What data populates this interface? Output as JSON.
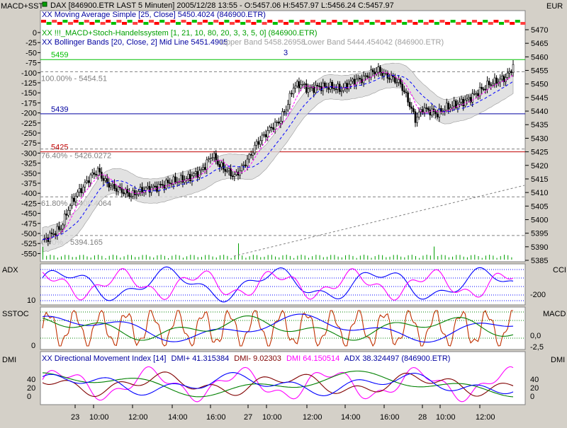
{
  "corner": {
    "left_title": "MACD+SST",
    "right_currency": "EUR"
  },
  "header": {
    "main": "DAX [846900.ETR LAST 5 Minuten] 2005/12/28 13:55 - O:5457.06 H:5457.97 L:5456.24 C:5457.97",
    "sma": "XX Moving Average Simple [25, Close] 5450.4024 (846900.ETR)",
    "system1": "XX !!!_MACD+Stoch-Handelssystem [1, 21, 10, 80, 20, 3, 3, 5, 0] (846900.ETR)",
    "bollinger": "XX Bollinger Bands [20, Close, 2] Mid Line 5451.4905",
    "bollinger_upper": "Upper Band 5458.26958",
    "bollinger_lower": "Lower Band 5444.454042 (846900.ETR)",
    "marker": "3"
  },
  "levels": {
    "line_5459": "5459",
    "line_5439": "5439",
    "line_5425": "5425",
    "fib_100": "100.00% - 5454.51",
    "fib_76": "76.40% - 5426.0272",
    "fib_61": "61.80% - 5408.4064",
    "fib_0": "0.00% - 5394.165"
  },
  "panels": {
    "adx_label": "ADX",
    "cci_label": "CCI",
    "sstoc_label": "SSTOC",
    "macd_label": "MACD",
    "dmi_label": "DMI",
    "dmi_right_label": "DMI",
    "dmi_header": "XX Directional Movement Index [14]",
    "dmi_plus": "DMI+ 41.315384",
    "dmi_minus": "DMI- 9.02303",
    "dmi_other": "DMI 64.150514",
    "dmi_adx": "ADX 38.324497 (846900.ETR)"
  },
  "colors": {
    "background": "#ffffff",
    "frame": "#d4d0c8",
    "candles": "#000000",
    "sma": "#0000ff",
    "price_line": "#ff00ff",
    "bollinger": "#808080",
    "level_green": "#00c000",
    "level_blue": "#0000a0",
    "level_red": "#c00000",
    "volume": "#00a000",
    "adx": "#0000ff",
    "cci": "#ff00ff",
    "stoch_k": "#c03000",
    "stoch_d": "#008000",
    "macd": "#0000ff",
    "dmi_plus": "#ff00ff",
    "dmi_minus": "#800000",
    "dmi_adx": "#008000"
  },
  "chart_data": {
    "type": "candlestick",
    "left_axis_ticks": [
      "0",
      "-25",
      "-50",
      "-75",
      "-100",
      "-125",
      "-150",
      "-175",
      "-200",
      "-225",
      "-250",
      "-275",
      "-300",
      "-325",
      "-350",
      "-375",
      "-400",
      "-425",
      "-450",
      "-475",
      "-500",
      "-525",
      "-550"
    ],
    "right_axis_ticks": [
      "5470",
      "5465",
      "5460",
      "5455",
      "5450",
      "5445",
      "5440",
      "5435",
      "5430",
      "5425",
      "5420",
      "5415",
      "5410",
      "5405",
      "5400",
      "5395",
      "5390",
      "5385"
    ],
    "ylim": [
      5383,
      5473
    ],
    "x_ticks": [
      "23",
      "10:00",
      "12:00",
      "14:00",
      "16:00",
      "27",
      "10:00",
      "12:00",
      "14:00",
      "16:00",
      "28",
      "10:00",
      "12:00"
    ],
    "close_anchors": [
      [
        0,
        5392
      ],
      [
        6,
        5395
      ],
      [
        10,
        5397
      ],
      [
        14,
        5404
      ],
      [
        18,
        5409
      ],
      [
        22,
        5412
      ],
      [
        26,
        5416
      ],
      [
        30,
        5418
      ],
      [
        34,
        5414
      ],
      [
        38,
        5412
      ],
      [
        42,
        5411
      ],
      [
        48,
        5409
      ],
      [
        54,
        5411
      ],
      [
        62,
        5412
      ],
      [
        70,
        5414
      ],
      [
        78,
        5415
      ],
      [
        86,
        5418
      ],
      [
        92,
        5424
      ],
      [
        96,
        5420
      ],
      [
        100,
        5418
      ],
      [
        104,
        5416
      ],
      [
        108,
        5419
      ],
      [
        112,
        5423
      ],
      [
        116,
        5428
      ],
      [
        120,
        5431
      ],
      [
        124,
        5434
      ],
      [
        128,
        5436
      ],
      [
        132,
        5441
      ],
      [
        136,
        5449
      ],
      [
        140,
        5450
      ],
      [
        144,
        5448
      ],
      [
        150,
        5449
      ],
      [
        156,
        5449
      ],
      [
        162,
        5448
      ],
      [
        168,
        5451
      ],
      [
        174,
        5452
      ],
      [
        178,
        5454
      ],
      [
        182,
        5455
      ],
      [
        186,
        5453
      ],
      [
        190,
        5452
      ],
      [
        194,
        5450
      ],
      [
        198,
        5444
      ],
      [
        202,
        5437
      ],
      [
        206,
        5441
      ],
      [
        210,
        5440
      ],
      [
        214,
        5439
      ],
      [
        218,
        5441
      ],
      [
        222,
        5442
      ],
      [
        226,
        5443
      ],
      [
        230,
        5444
      ],
      [
        234,
        5446
      ],
      [
        238,
        5448
      ],
      [
        242,
        5450
      ],
      [
        246,
        5451
      ],
      [
        250,
        5452
      ],
      [
        253,
        5454
      ],
      [
        255,
        5457
      ]
    ],
    "sstoc_ticks": [
      "0"
    ],
    "macd_ticks": [
      "0,0",
      "-2,5"
    ],
    "adx_ticks": [
      "10"
    ],
    "cci_ticks": [
      "-200"
    ],
    "dmi_ticks": [
      "40",
      "20",
      "0"
    ],
    "dmi_right_ticks": [
      "40",
      "20",
      "0"
    ]
  }
}
